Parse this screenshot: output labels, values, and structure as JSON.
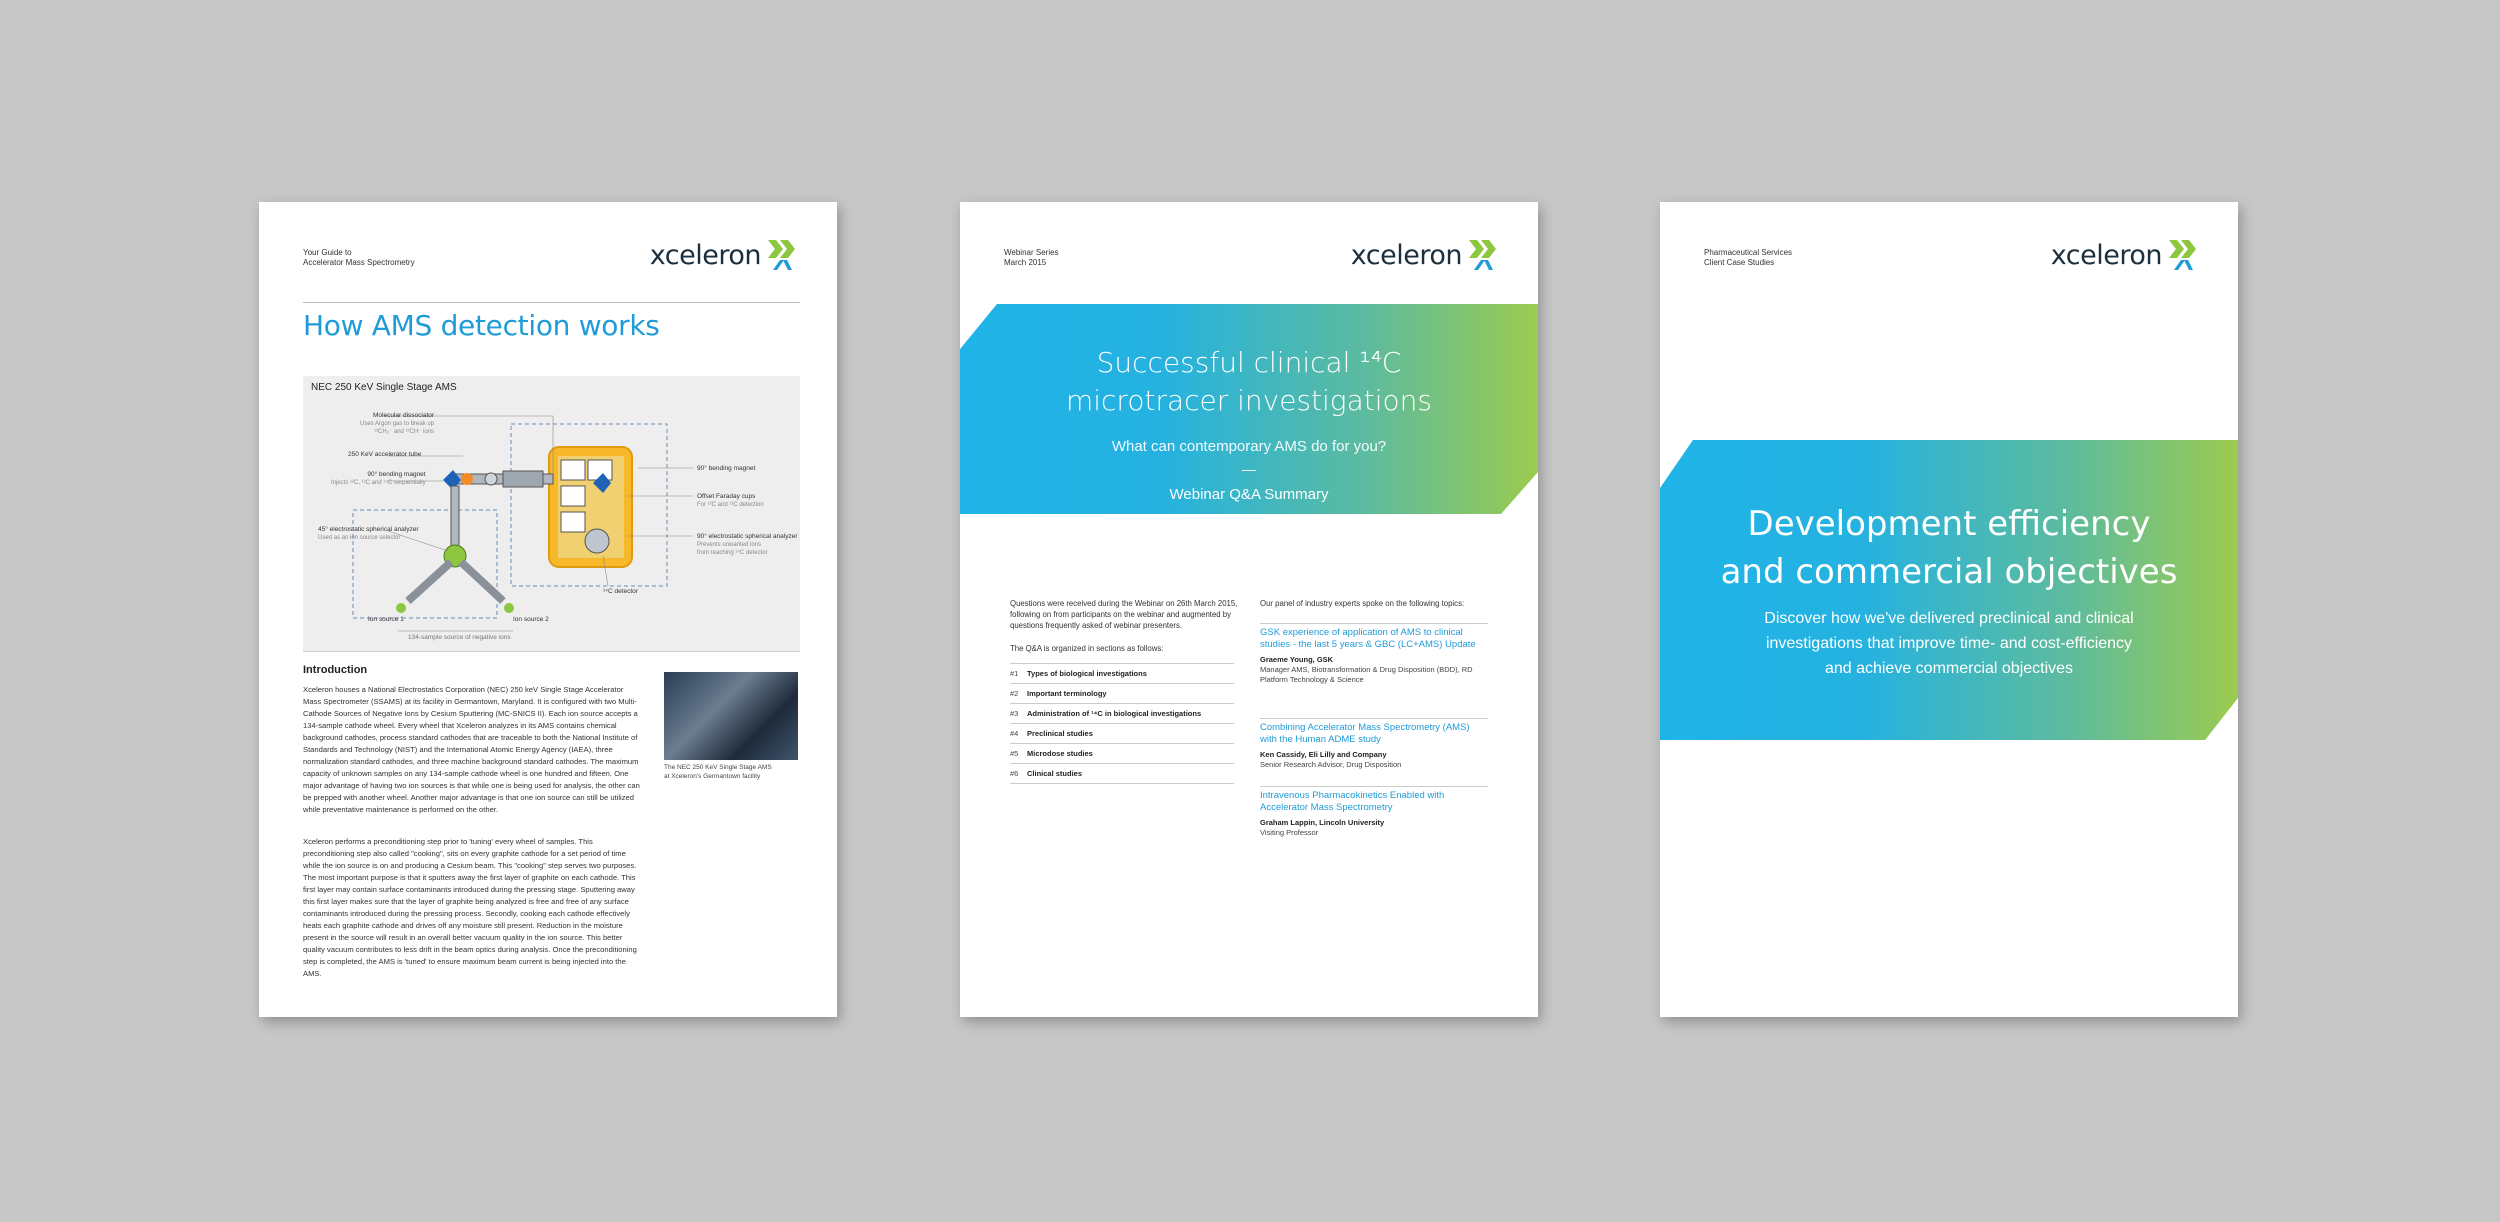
{
  "brand": {
    "logo_text": "xceleron",
    "logo_blue": "#1f9bd7",
    "logo_green": "#8dc63f"
  },
  "page1": {
    "header_line1": "Your Guide to",
    "header_line2": "Accelerator Mass Spectrometry",
    "title": "How AMS detection works",
    "diagram": {
      "title": "NEC 250 KeV Single Stage AMS",
      "labels": {
        "mol_diss": "Molecular dissociator",
        "mol_diss_sub": "Uses Argon gas to break up",
        "mol_diss_sub2": "¹³CH₂⁻ and ¹²CH⁻ ions",
        "tube": "250 KeV accelerator tube",
        "bend90": "90° bending magnet",
        "bend90_sub": "Injects ¹²C, ¹³C and ¹⁴C sequentially",
        "esa45": "45° electrostatic spherical analyzer",
        "esa45_sub": "Used as an ion source selector",
        "ion1": "Ion source 1",
        "ion2": "Ion source 2",
        "samples": "134-sample source of negative ions",
        "bend90r": "90° bending magnet",
        "faraday": "Offset Faraday cups",
        "faraday_sub": "For ¹²C and ¹³C detection",
        "esa90": "90° electrostatic spherical analyzer",
        "esa90_sub": "Prevents unwanted ions",
        "esa90_sub2": "from reaching ¹⁴C detector",
        "detector": "¹⁴C detector"
      }
    },
    "intro_heading": "Introduction",
    "intro_p1": "Xceleron houses a National Electrostatics Corporation (NEC) 250 keV Single Stage Accelerator Mass Spectrometer (SSAMS) at its facility in Germantown, Maryland. It is configured with two Multi-Cathode Sources of Negative Ions by Cesium Sputtering (MC-SNICS II). Each ion source accepts a 134-sample cathode wheel. Every wheel that Xceleron analyzes in its AMS contains chemical background cathodes, process standard cathodes that are traceable to both the National Institute of Standards and Technology (NIST) and the International Atomic Energy Agency (IAEA), three normalization standard cathodes, and three machine background standard cathodes. The maximum capacity of unknown samples on any 134-sample cathode wheel is one hundred and fifteen. One major advantage of having two ion sources is that while one is being used for analysis, the other can be prepped with another wheel. Another major advantage is that one ion source can still be utilized while preventative maintenance is performed on the other.",
    "intro_p2": "Xceleron performs a preconditioning step prior to 'tuning' every wheel of samples. This preconditioning step also called \"cooking\", sits on every graphite cathode for a set period of time while the ion source is on and producing a Cesium beam. This \"cooking\" step serves two purposes. The most important purpose is that it sputters away the first layer of graphite on each cathode. This first layer may contain surface contaminants introduced during the pressing stage. Sputtering away this first layer makes sure that the layer of graphite being analyzed is free and free of any surface contaminants introduced during the pressing process. Secondly, cooking each cathode effectively heats each graphite cathode and drives off any moisture still present. Reduction in the moisture present in the source will result in an overall better vacuum quality in the ion source. This better quality vacuum contributes to less drift in the beam optics during analysis. Once the preconditioning step is completed, the AMS is 'tuned' to ensure maximum beam current is being injected into the AMS.",
    "photo_caption_1": "The NEC 250 KeV Single Stage AMS",
    "photo_caption_2": "at Xceleron's Germantown facility"
  },
  "page2": {
    "header_line1": "Webinar Series",
    "header_line2": "March 2015",
    "title_line1": "Successful clinical ¹⁴C",
    "title_line2": "microtracer investigations",
    "subtitle": "What can contemporary AMS do for you?",
    "dash": "—",
    "subtitle2": "Webinar Q&A Summary",
    "intro": "Questions were received during the Webinar on 26th March 2015, following on from participants on the webinar and augmented by questions frequently asked of webinar presenters.",
    "organized": "The Q&A is organized in sections as follows:",
    "sections": [
      {
        "num": "#1",
        "label": "Types of biological investigations"
      },
      {
        "num": "#2",
        "label": "Important terminology"
      },
      {
        "num": "#3",
        "label": "Administration of ¹⁴C in biological investigations"
      },
      {
        "num": "#4",
        "label": "Preclinical studies"
      },
      {
        "num": "#5",
        "label": "Microdose studies"
      },
      {
        "num": "#6",
        "label": "Clinical studies"
      }
    ],
    "panel_intro": "Our panel of industry experts spoke on the following topics:",
    "topics": [
      {
        "title": "GSK experience of application of AMS to clinical studies - the last 5 years & GBC (LC+AMS) Update",
        "speaker": "Graeme Young, GSK",
        "role": "Manager AMS, Biotransformation & Drug Disposition (BDD), RD Platform Technology & Science"
      },
      {
        "title": "Combining Accelerator Mass Spectrometry (AMS) with the Human ADME study",
        "speaker": "Ken Cassidy, Eli Lilly and Company",
        "role": "Senior Research Advisor, Drug Disposition"
      },
      {
        "title": "Intravenous Pharmacokinetics Enabled with Accelerator Mass Spectrometry",
        "speaker": "Graham Lappin, Lincoln University",
        "role": "Visiting Professor"
      }
    ]
  },
  "page3": {
    "header_line1": "Pharmaceutical Services",
    "header_line2": "Client Case Studies",
    "title_line1": "Development efficiency",
    "title_line2": "and commercial objectives",
    "sub_line1": "Discover how we've delivered preclinical and clinical",
    "sub_line2": "investigations that improve time- and cost-efficiency",
    "sub_line3": "and achieve commercial objectives"
  }
}
